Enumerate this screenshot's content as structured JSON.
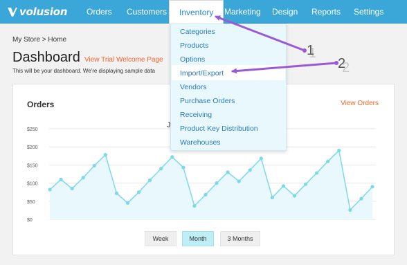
{
  "app": {
    "brand": "volusion",
    "accent_color": "#3aa7d8",
    "link_color": "#f0652b",
    "highlight_color": "#9a59d6"
  },
  "nav": {
    "items": [
      {
        "label": "Orders"
      },
      {
        "label": "Customers"
      },
      {
        "label": "Inventory",
        "active": true
      },
      {
        "label": "Marketing"
      },
      {
        "label": "Design"
      },
      {
        "label": "Reports"
      },
      {
        "label": "Settings"
      }
    ]
  },
  "inventory_menu": {
    "items": [
      {
        "label": "Categories"
      },
      {
        "label": "Products"
      },
      {
        "label": "Options"
      },
      {
        "label": "Import/Export",
        "hovered": true
      },
      {
        "label": "Vendors"
      },
      {
        "label": "Purchase Orders"
      },
      {
        "label": "Receiving"
      },
      {
        "label": "Product Key Distribution"
      },
      {
        "label": "Warehouses"
      }
    ]
  },
  "page": {
    "breadcrumb": "My Store > Home",
    "title": "Dashboard",
    "welcome_link": "View Trial Welcome Page",
    "subtitle": "This will be your dashboard. We're displaying sample data"
  },
  "orders_card": {
    "title": "Orders",
    "view_link": "View Orders",
    "partial_label": "J",
    "range_buttons": [
      {
        "label": "Week",
        "selected": false
      },
      {
        "label": "Month",
        "selected": true
      },
      {
        "label": "3 Months",
        "selected": false
      }
    ]
  },
  "annotations": {
    "step1": "1",
    "step2": "2"
  },
  "chart_data": {
    "type": "area",
    "title": "Orders",
    "y_ticks": [
      "$0",
      "$50",
      "$100",
      "$150",
      "$200",
      "$250"
    ],
    "ylim": [
      0,
      250
    ],
    "grid": true,
    "series": [
      {
        "color": "#7dd8ec",
        "values": [
          82,
          110,
          85,
          115,
          148,
          178,
          72,
          45,
          75,
          108,
          140,
          172,
          143,
          37,
          68,
          100,
          130,
          105,
          136,
          168,
          60,
          92,
          65,
          97,
          128,
          160,
          190,
          26,
          57,
          90
        ]
      }
    ]
  }
}
